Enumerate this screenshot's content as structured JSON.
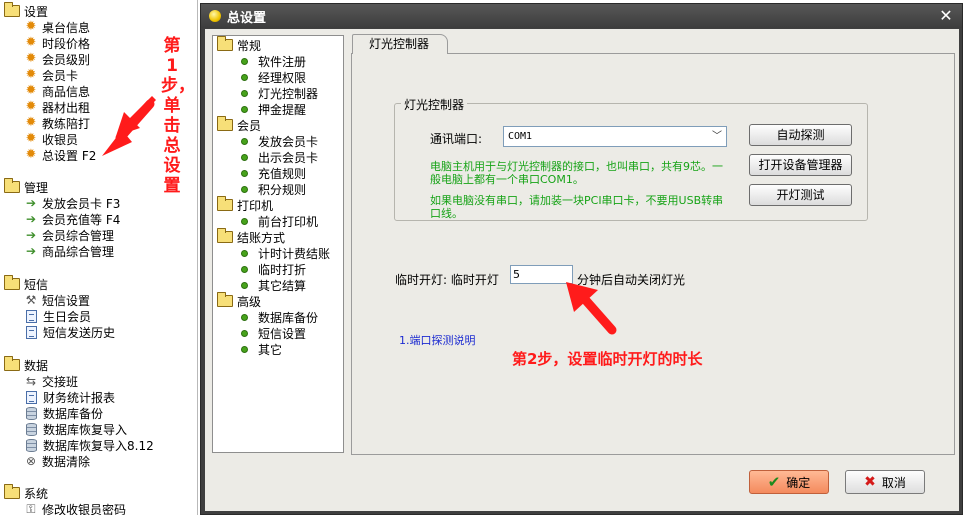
{
  "sidebar": {
    "groups": [
      {
        "label": "设置",
        "items": [
          {
            "label": "桌台信息",
            "icon": "gear-icon"
          },
          {
            "label": "时段价格",
            "icon": "gear-icon"
          },
          {
            "label": "会员级别",
            "icon": "gear-icon"
          },
          {
            "label": "会员卡",
            "icon": "gear-icon"
          },
          {
            "label": "商品信息",
            "icon": "gear-icon"
          },
          {
            "label": "器材出租",
            "icon": "gear-icon"
          },
          {
            "label": "教练陪打",
            "icon": "gear-icon"
          },
          {
            "label": "收银员",
            "icon": "gear-icon"
          },
          {
            "label": "总设置 F2",
            "icon": "gear-icon"
          }
        ]
      },
      {
        "label": "管理",
        "items": [
          {
            "label": "发放会员卡 F3",
            "icon": "arrow-icon"
          },
          {
            "label": "会员充值等 F4",
            "icon": "arrow-icon"
          },
          {
            "label": "会员综合管理",
            "icon": "arrow-icon"
          },
          {
            "label": "商品综合管理",
            "icon": "arrow-icon"
          }
        ]
      },
      {
        "label": "短信",
        "items": [
          {
            "label": "短信设置",
            "icon": "tools-icon"
          },
          {
            "label": "生日会员",
            "icon": "document-icon"
          },
          {
            "label": "短信发送历史",
            "icon": "document-icon"
          }
        ]
      },
      {
        "label": "数据",
        "items": [
          {
            "label": "交接班",
            "icon": "handover-icon"
          },
          {
            "label": "财务统计报表",
            "icon": "document-icon"
          },
          {
            "label": "数据库备份",
            "icon": "database-icon"
          },
          {
            "label": "数据库恢复导入",
            "icon": "database-icon"
          },
          {
            "label": "数据库恢复导入8.12",
            "icon": "database-icon"
          },
          {
            "label": "数据清除",
            "icon": "clear-icon"
          }
        ]
      },
      {
        "label": "系统",
        "items": [
          {
            "label": "修改收银员密码",
            "icon": "key-icon"
          }
        ]
      }
    ]
  },
  "annotations": {
    "step1": "第1步，单击总设置",
    "step2": "第2步，设置临时开灯的时长",
    "color": "#ff1b1b"
  },
  "dialog": {
    "title": "总设置",
    "nav": [
      {
        "label": "常规",
        "items": [
          "软件注册",
          "经理权限",
          "灯光控制器",
          "押金提醒"
        ]
      },
      {
        "label": "会员",
        "items": [
          "发放会员卡",
          "出示会员卡",
          "充值规则",
          "积分规则"
        ]
      },
      {
        "label": "打印机",
        "items": [
          "前台打印机"
        ]
      },
      {
        "label": "结账方式",
        "items": [
          "计时计费结账",
          "临时打折",
          "其它结算"
        ]
      },
      {
        "label": "高级",
        "items": [
          "数据库备份",
          "短信设置",
          "其它"
        ]
      }
    ],
    "tab": "灯光控制器",
    "group_title": "灯光控制器",
    "port_label": "通讯端口:",
    "port_value": "COM1",
    "help_line1": "电脑主机用于与灯光控制器的接口，也叫串口，共有9芯。一般电脑上都有一个串口COM1。",
    "help_line2": "如果电脑没有串口，请加装一块PCI串口卡，不要用USB转串口线。",
    "buttons": {
      "auto_detect": "自动探测",
      "device_manager": "打开设备管理器",
      "light_test": "开灯测试",
      "ok": "确定",
      "cancel": "取消"
    },
    "temp_label": "临时开灯: 临时开灯",
    "temp_minutes": "5",
    "temp_suffix": "分钟后自动关闭灯光",
    "port_help_link": "1.端口探测说明"
  }
}
